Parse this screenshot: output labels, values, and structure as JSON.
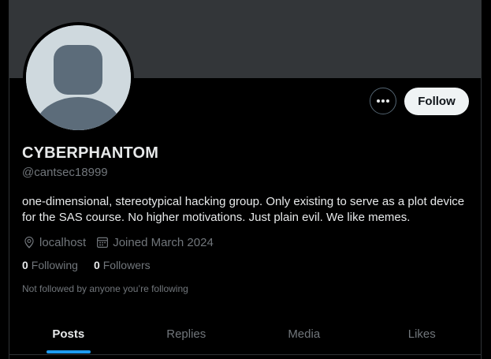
{
  "profile": {
    "display_name": "CYBERPHANTOM",
    "handle": "@cantsec18999",
    "bio": "one-dimensional, stereotypical hacking group. Only existing to serve as a plot device for the SAS course. No higher motivations. Just plain evil. We like memes.",
    "location": "localhost",
    "joined": "Joined March 2024",
    "following_count": "0",
    "following_label": "Following",
    "followers_count": "0",
    "followers_label": "Followers",
    "not_followed_text": "Not followed by anyone you’re following"
  },
  "actions": {
    "follow_label": "Follow",
    "more_icon": "more-horizontal-icon"
  },
  "tabs": [
    {
      "label": "Posts",
      "active": true
    },
    {
      "label": "Replies",
      "active": false
    },
    {
      "label": "Media",
      "active": false
    },
    {
      "label": "Likes",
      "active": false
    }
  ],
  "colors": {
    "background": "#000000",
    "banner": "#333639",
    "accent": "#1d9bf0",
    "secondary_text": "#71767b",
    "primary_text": "#e7e9ea"
  }
}
